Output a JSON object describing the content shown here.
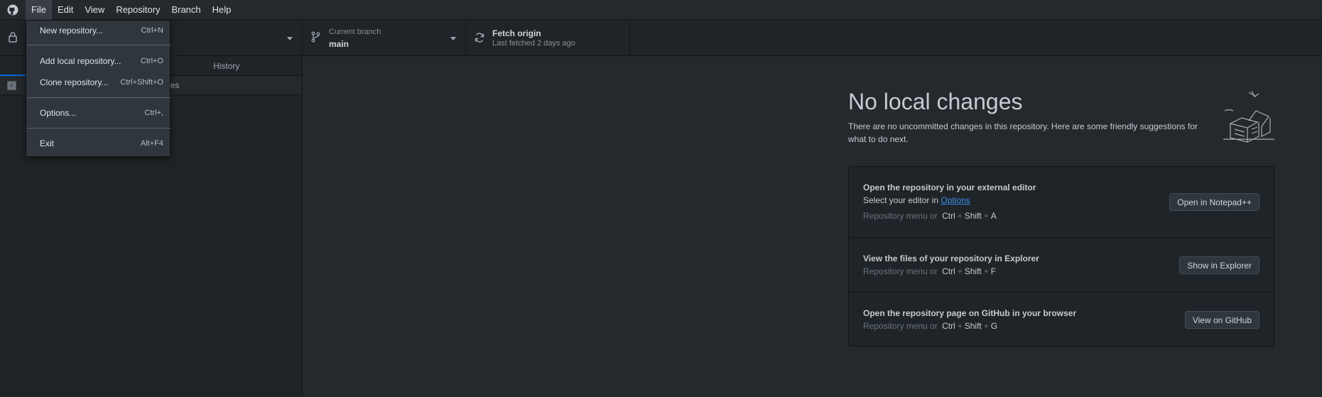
{
  "menubar": {
    "items": [
      "File",
      "Edit",
      "View",
      "Repository",
      "Branch",
      "Help"
    ]
  },
  "toolbar": {
    "branch_caption": "Current branch",
    "branch_name": "main",
    "fetch_title": "Fetch origin",
    "fetch_subtitle": "Last fetched 2 days ago"
  },
  "tabs": {
    "history": "History"
  },
  "changes": {
    "partial_label": "les"
  },
  "file_menu": {
    "items": [
      {
        "label": "New repository...",
        "accel": "Ctrl+N"
      },
      {
        "label": "Add local repository...",
        "accel": "Ctrl+O"
      },
      {
        "label": "Clone repository...",
        "accel": "Ctrl+Shift+O"
      },
      {
        "label": "Options...",
        "accel": "Ctrl+,"
      },
      {
        "label": "Exit",
        "accel": "Alt+F4"
      }
    ]
  },
  "blank": {
    "title": "No local changes",
    "description": "There are no uncommitted changes in this repository. Here are some friendly suggestions for what to do next."
  },
  "suggestions": [
    {
      "title": "Open the repository in your external editor",
      "desc_prefix": "Select your editor in ",
      "desc_link": "Options",
      "shortcut_prefix": "Repository menu or",
      "keys": [
        "Ctrl",
        "Shift",
        "A"
      ],
      "button": "Open in Notepad++"
    },
    {
      "title": "View the files of your repository in Explorer",
      "shortcut_prefix": "Repository menu or",
      "keys": [
        "Ctrl",
        "Shift",
        "F"
      ],
      "button": "Show in Explorer"
    },
    {
      "title": "Open the repository page on GitHub in your browser",
      "shortcut_prefix": "Repository menu or",
      "keys": [
        "Ctrl",
        "Shift",
        "G"
      ],
      "button": "View on GitHub"
    }
  ],
  "colors": {
    "accent": "#0366d6",
    "link": "#3b8eea",
    "background": "#24292e"
  }
}
